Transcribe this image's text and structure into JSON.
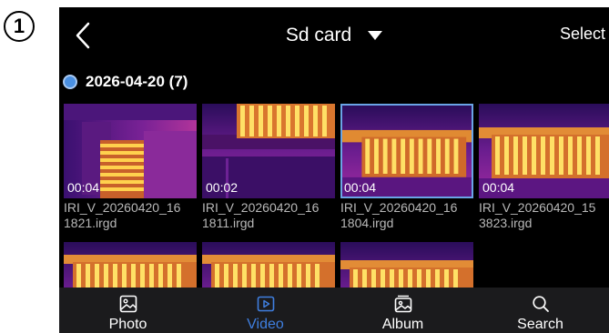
{
  "step_badge": "1",
  "header": {
    "title": "Sd card",
    "select_label": "Select"
  },
  "group": {
    "date_label": "2026-04-20 (7)"
  },
  "media": [
    {
      "duration": "00:04",
      "filename": "IRI_V_20260420_16\n1821.irgd",
      "selected": false
    },
    {
      "duration": "00:02",
      "filename": "IRI_V_20260420_16\n1811.irgd",
      "selected": false
    },
    {
      "duration": "00:04",
      "filename": "IRI_V_20260420_16\n1804.irgd",
      "selected": true
    },
    {
      "duration": "00:04",
      "filename": "IRI_V_20260420_15\n3823.irgd",
      "selected": false
    },
    {
      "duration": "",
      "filename": "",
      "selected": false
    },
    {
      "duration": "",
      "filename": "",
      "selected": false
    },
    {
      "duration": "",
      "filename": "",
      "selected": false
    }
  ],
  "bottom_nav": [
    {
      "label": "Photo",
      "icon": "photo-icon",
      "active": false
    },
    {
      "label": "Video",
      "icon": "video-icon",
      "active": true
    },
    {
      "label": "Album",
      "icon": "album-icon",
      "active": false
    },
    {
      "label": "Search",
      "icon": "search-icon",
      "active": false
    }
  ],
  "colors": {
    "active": "#3f7fe0",
    "background": "#000000",
    "nav_bar": "#1b1b1d",
    "selection_border": "#6aa4e6"
  }
}
